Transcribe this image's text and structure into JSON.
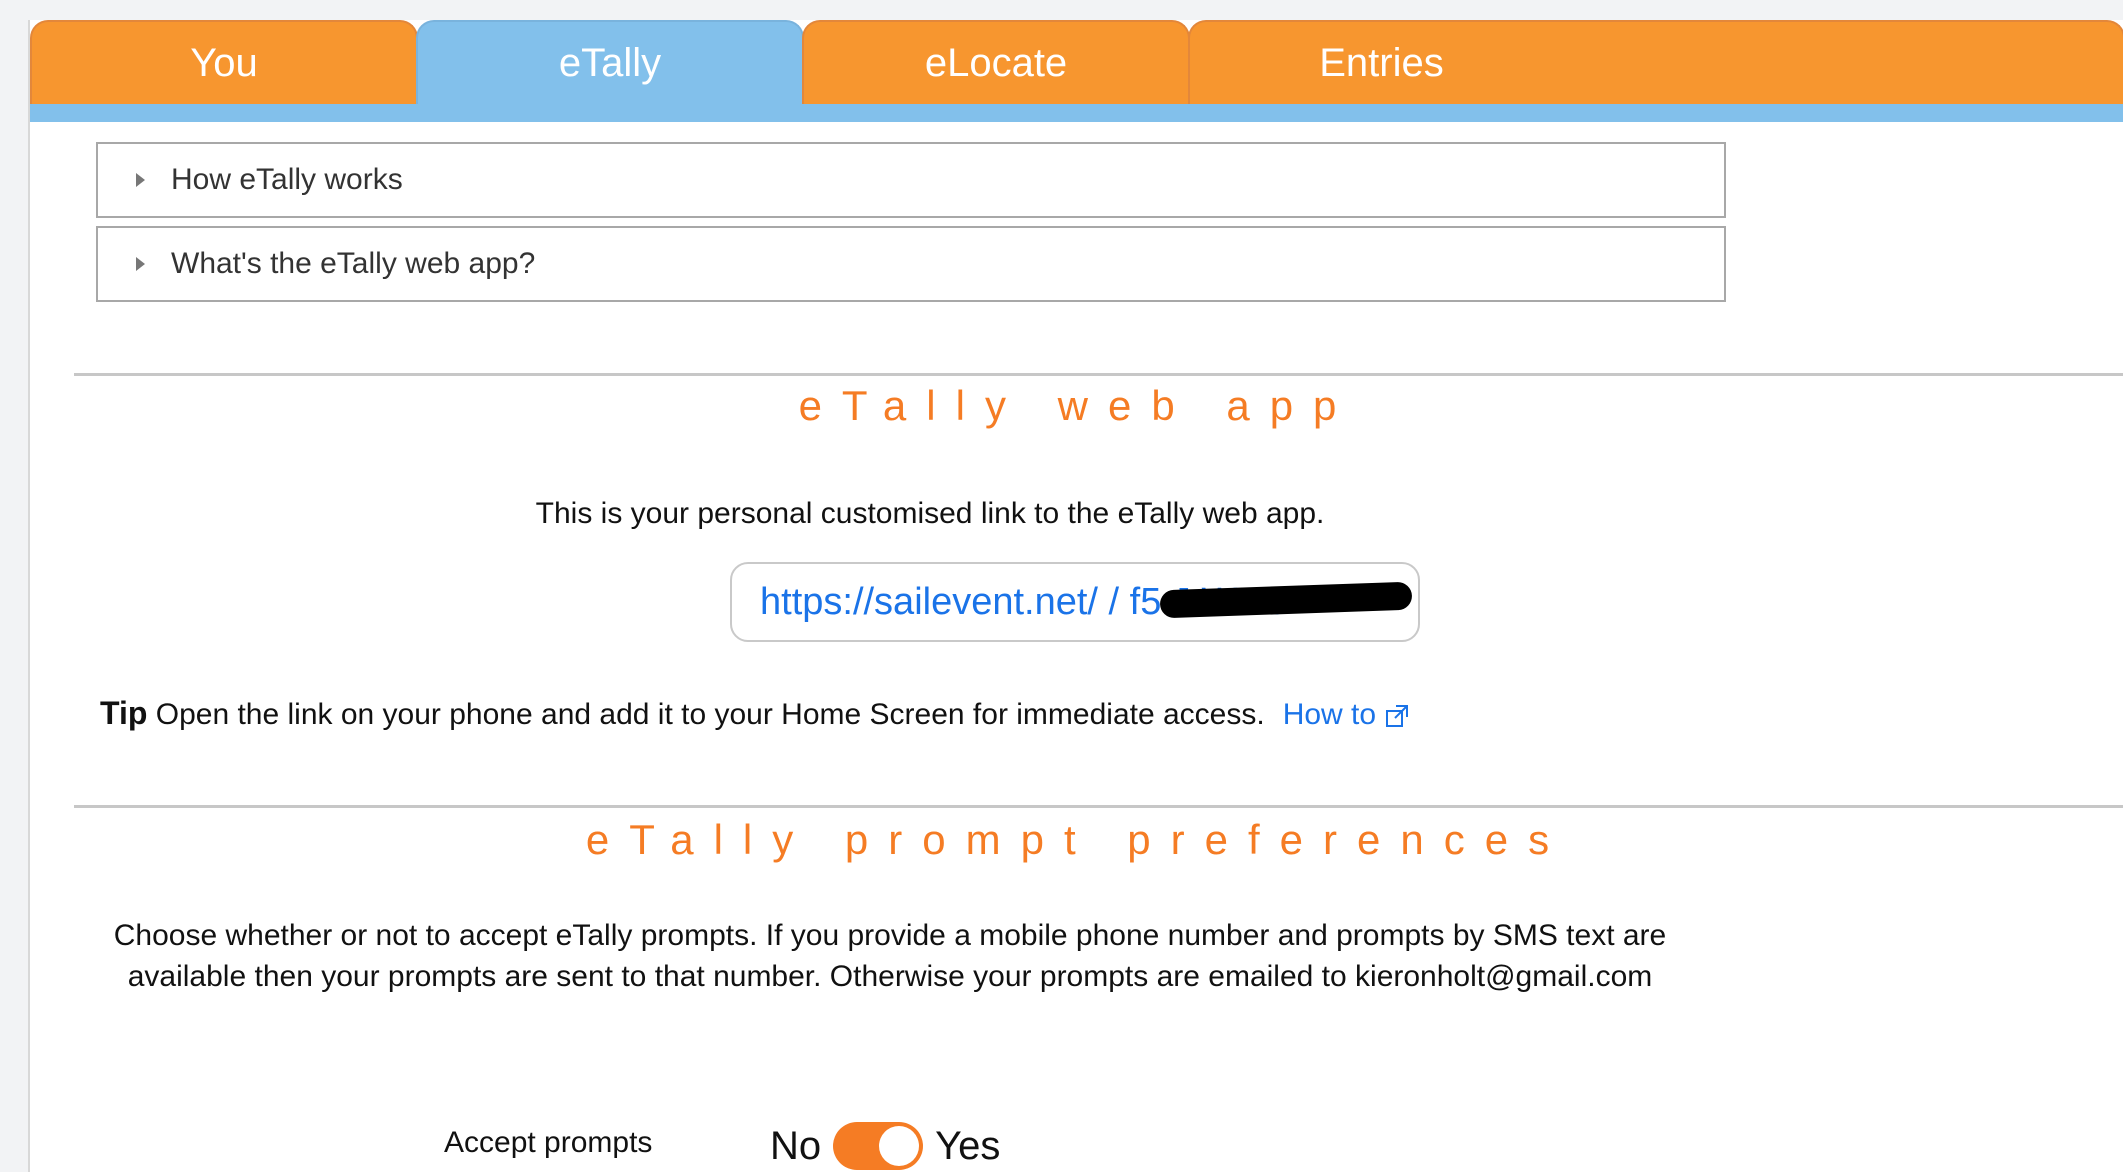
{
  "tabs": [
    {
      "label": "You",
      "active": false
    },
    {
      "label": "eTally",
      "active": true
    },
    {
      "label": "eLocate",
      "active": false
    },
    {
      "label": "Entries",
      "active": false
    }
  ],
  "accordion": [
    {
      "label": "How eTally works"
    },
    {
      "label": "What's the eTally web app?"
    }
  ],
  "webapp": {
    "title": "eTally web app",
    "intro": "This is your personal customised link to the eTally web app.",
    "link_text": "https://sailevent.net/ / f5 J WC /",
    "tip_label": "Tip",
    "tip_text": " Open the link on your phone and add it to your Home Screen for immediate access.",
    "howto_label": "How to"
  },
  "prompts": {
    "title": "eTally prompt preferences",
    "description": "Choose whether or not to accept eTally prompts. If you provide a mobile phone number and prompts by SMS text are available then your prompts are sent to that number. Otherwise your prompts are emailed to kieronholt@gmail.com",
    "accept_label": "Accept prompts",
    "toggle_off_label": "No",
    "toggle_on_label": "Yes",
    "toggle_state": "Yes"
  },
  "colors": {
    "accent_orange": "#f7962f",
    "active_tab_blue": "#82c0eb",
    "title_orange": "#f57c24",
    "link_blue": "#1a73e8"
  },
  "icons": {
    "accordion": "triangle-right-icon",
    "external_link": "external-link-icon"
  }
}
